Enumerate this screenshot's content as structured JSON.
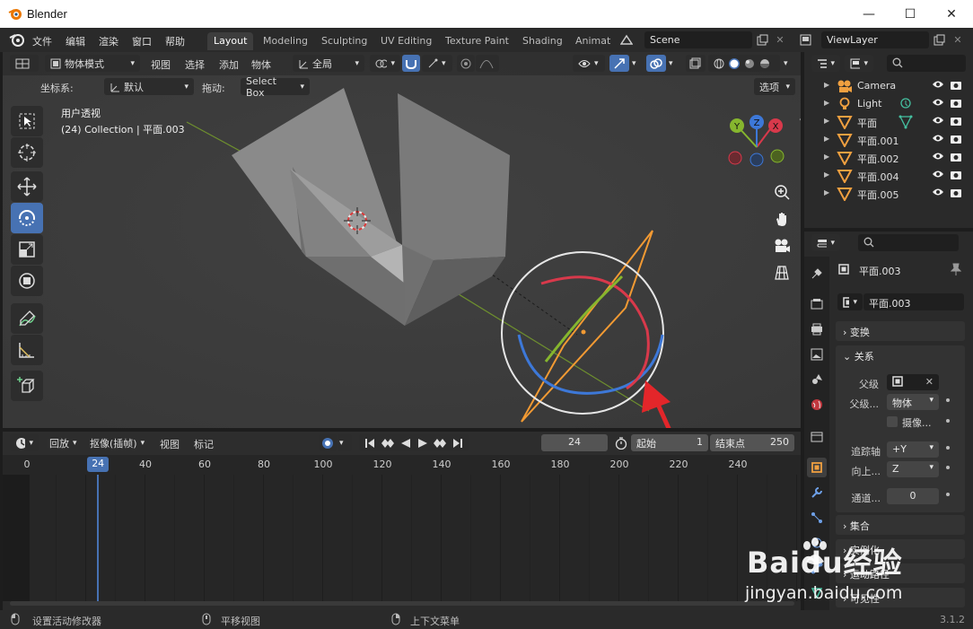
{
  "window": {
    "title": "Blender",
    "minimize": "—",
    "maximize": "☐",
    "close": "✕"
  },
  "menu": {
    "file": "文件",
    "edit": "编辑",
    "render": "渲染",
    "window": "窗口",
    "help": "帮助"
  },
  "workspaces": [
    "Layout",
    "Modeling",
    "Sculpting",
    "UV Editing",
    "Texture Paint",
    "Shading",
    "Animat"
  ],
  "scene": {
    "name": "Scene",
    "view_layer": "ViewLayer"
  },
  "viewport": {
    "mode": "物体模式",
    "menus": [
      "视图",
      "选择",
      "添加",
      "物体"
    ],
    "transform_orientation": "全局",
    "coord_label": "坐标系:",
    "coord_value": "默认",
    "drag_label": "拖动:",
    "drag_value": "Select Box",
    "options": "选项",
    "perspective": "用户透视",
    "collection_info": "(24) Collection | 平面.003",
    "gizmo_axes": {
      "x": "X",
      "y": "Y",
      "z": "Z"
    }
  },
  "timeline": {
    "menus": [
      "回放",
      "抠像(插帧)",
      "视图",
      "标记"
    ],
    "current_frame": "24",
    "start_label": "起始",
    "start_value": "1",
    "end_label": "结束点",
    "end_value": "250",
    "ticks": [
      "0",
      "20",
      "40",
      "60",
      "80",
      "100",
      "120",
      "140",
      "160",
      "180",
      "200",
      "220",
      "240"
    ],
    "tick_values": [
      0,
      20,
      40,
      60,
      80,
      100,
      120,
      140,
      160,
      180,
      200,
      220,
      240
    ],
    "frame_value": 24
  },
  "outliner": {
    "items": [
      {
        "name": "Camera",
        "icon": "camera-icon"
      },
      {
        "name": "Light",
        "icon": "light-icon"
      },
      {
        "name": "平面",
        "icon": "mesh-icon"
      },
      {
        "name": "平面.001",
        "icon": "mesh-icon"
      },
      {
        "name": "平面.002",
        "icon": "mesh-icon"
      },
      {
        "name": "平面.004",
        "icon": "mesh-icon"
      },
      {
        "name": "平面.005",
        "icon": "mesh-icon"
      }
    ]
  },
  "properties": {
    "object_name": "平面.003",
    "object_field": "平面.003",
    "transform": "变换",
    "relations": "关系",
    "parent_label": "父级",
    "parent_type_label": "父级...",
    "parent_type_value": "物体",
    "camera_label": "摄像...",
    "track_axis_label": "追踪轴",
    "track_axis_value": "+Y",
    "up_axis_label": "向上...",
    "up_axis_value": "Z",
    "pass_index_label": "通道...",
    "pass_index_value": "0",
    "collections": "集合",
    "instancing": "实例化",
    "motion_paths": "运动路径",
    "visibility": "可见性"
  },
  "status": {
    "left": "设置活动修改器",
    "middle": "平移视图",
    "right": "上下文菜单",
    "version": "3.1.2"
  },
  "watermark": {
    "brand": "Baidu经验",
    "url": "jingyan.baidu.com"
  },
  "colors": {
    "accent": "#4772b3",
    "arrow": "#e3262a",
    "selection": "#f29a33",
    "x_axis": "#d8394b",
    "y_axis": "#86b62e",
    "z_axis": "#3d78d8"
  }
}
